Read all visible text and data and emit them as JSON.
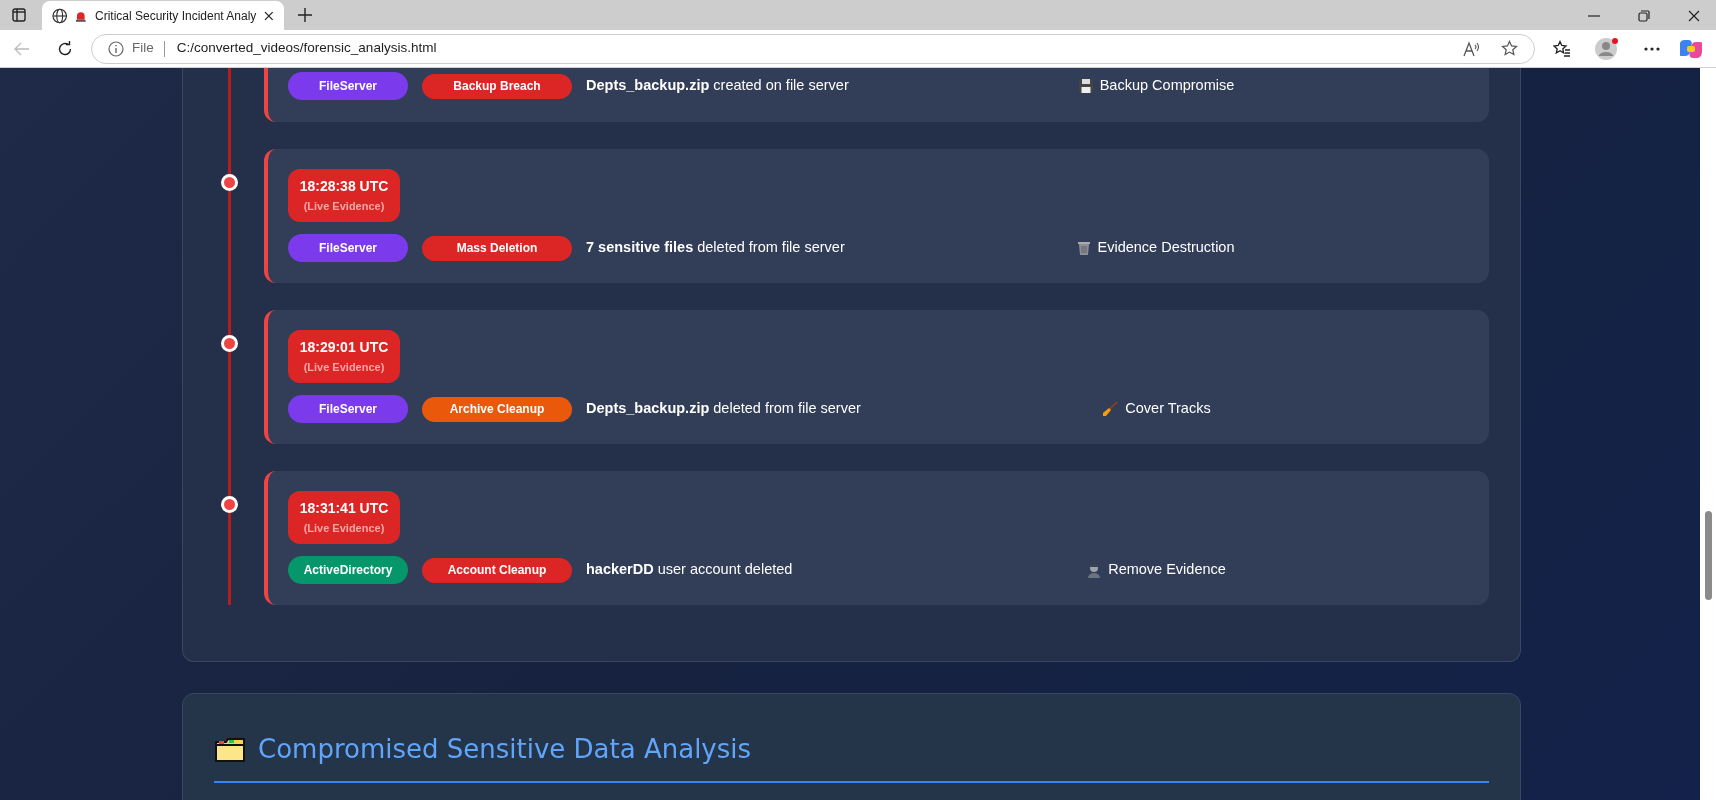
{
  "browser": {
    "tab_title": "Critical Security Incident Analy",
    "address_scheme": "File",
    "address": "C:/converted_videos/forensic_analysis.html"
  },
  "timeline": {
    "events": [
      {
        "source": {
          "label": "FileServer",
          "color": "#7c3aed"
        },
        "category": {
          "label": "Backup Breach",
          "color": "#dc2626"
        },
        "description": "**Depts_backup.zip** created on file server",
        "impact": {
          "kind": "floppy",
          "label": "Backup Compromise"
        }
      },
      {
        "time": "18:28:38 UTC",
        "note": "(Live Evidence)",
        "source": {
          "label": "FileServer",
          "color": "#7c3aed"
        },
        "category": {
          "label": "Mass Deletion",
          "color": "#dc2626"
        },
        "description": "**7 sensitive files** deleted from file server",
        "impact": {
          "kind": "trash",
          "label": "Evidence Destruction"
        }
      },
      {
        "time": "18:29:01 UTC",
        "note": "(Live Evidence)",
        "source": {
          "label": "FileServer",
          "color": "#7c3aed"
        },
        "category": {
          "label": "Archive Cleanup",
          "color": "#ea580c"
        },
        "description": "**Depts_backup.zip** deleted from file server",
        "impact": {
          "kind": "broom",
          "label": "Cover Tracks"
        }
      },
      {
        "time": "18:31:41 UTC",
        "note": "(Live Evidence)",
        "source": {
          "label": "ActiveDirectory",
          "color": "#059669"
        },
        "category": {
          "label": "Account Cleanup",
          "color": "#dc2626"
        },
        "description": "**hackerDD** user account deleted",
        "impact": {
          "kind": "person",
          "label": "Remove Evidence"
        }
      }
    ]
  },
  "section": {
    "title": "Compromised Sensitive Data Analysis"
  }
}
